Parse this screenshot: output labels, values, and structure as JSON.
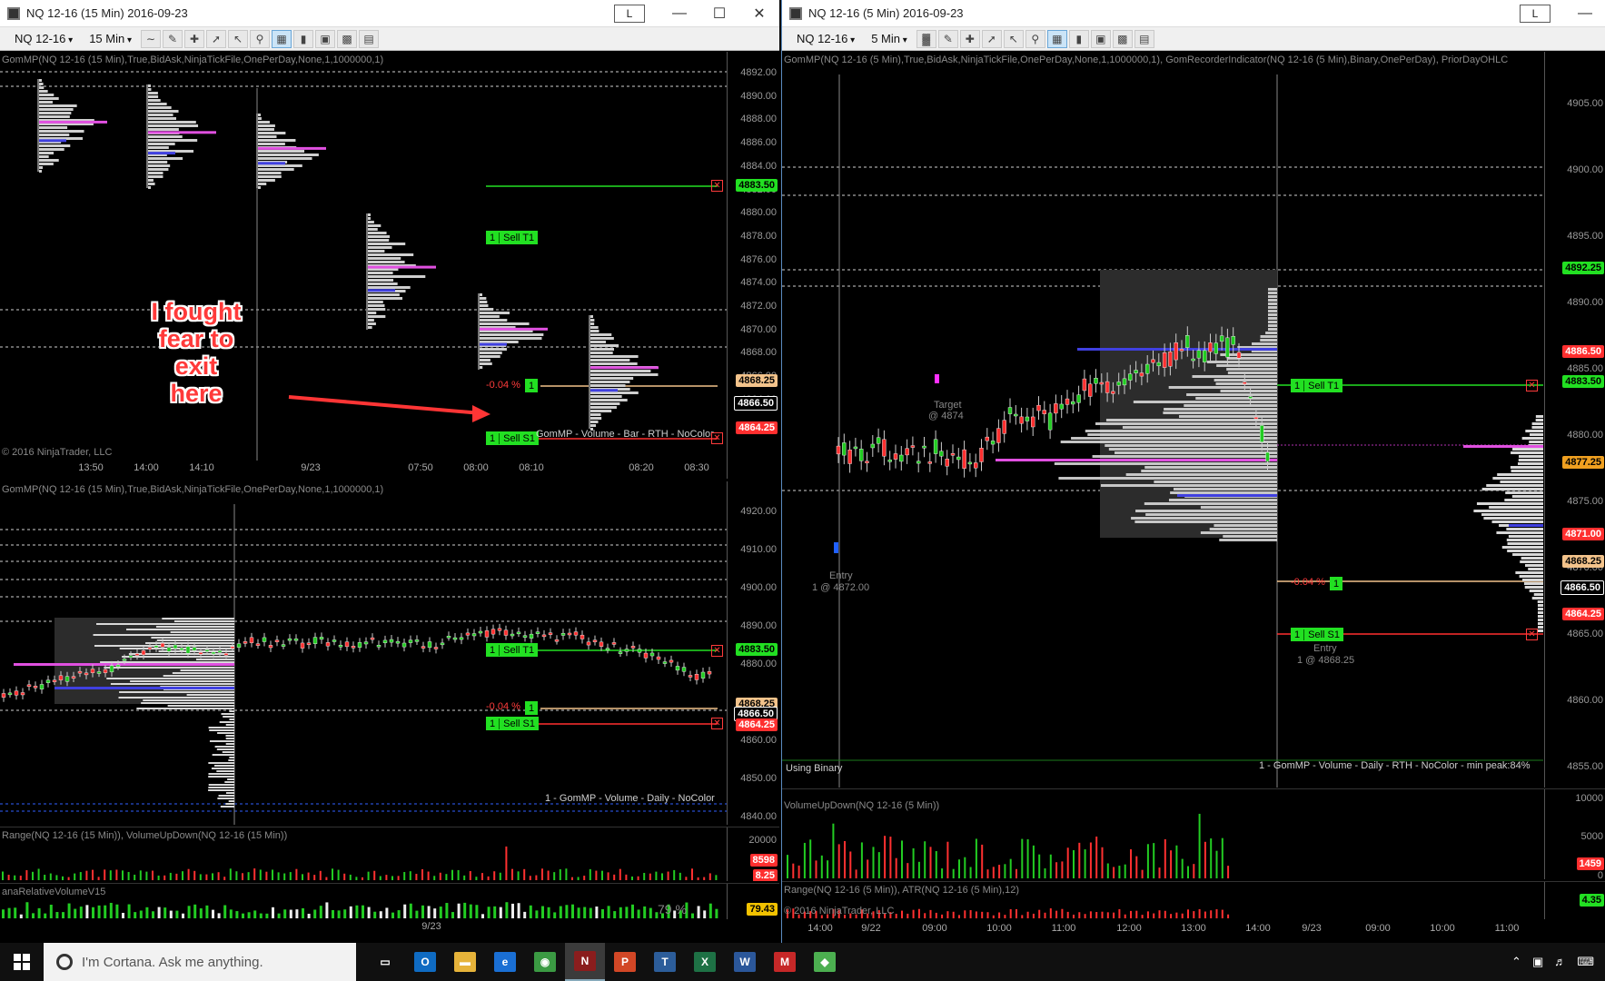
{
  "left_window": {
    "title": "NQ 12-16 (15 Min)  2016-09-23",
    "link_label": "L",
    "toolbar": {
      "instrument": "NQ 12-16",
      "interval": "15 Min"
    },
    "top_chart": {
      "indicator_label": "GomMP(NQ 12-16 (15 Min),True,BidAsk,NinjaTickFile,OnePerDay,None,1,1000000,1)",
      "copyright": "© 2016 NinjaTrader, LLC",
      "price_ticks": [
        "4892.00",
        "4890.00",
        "4888.00",
        "4886.00",
        "4884.00",
        "4882.00",
        "4880.00",
        "4878.00",
        "4876.00",
        "4874.00",
        "4872.00",
        "4870.00",
        "4868.00",
        "4866.00",
        "4864.00"
      ],
      "price_tags": [
        {
          "label": "4883.50",
          "bg": "#22e022",
          "fg": "#000"
        },
        {
          "label": "4868.25",
          "bg": "#f3c38b",
          "fg": "#000"
        },
        {
          "label": "4866.50",
          "bg": "#000",
          "fg": "#fff"
        },
        {
          "label": "4864.25",
          "bg": "#ff2f2f",
          "fg": "#fff"
        }
      ],
      "sell_t1": {
        "qty": "1",
        "label": "Sell T1"
      },
      "sell_s1": {
        "qty": "1",
        "label": "Sell S1"
      },
      "pnl_pct": "-0.04 %",
      "pos_qty": "1",
      "profile_note": "GomMP - Volume - Bar - RTH - NoColor",
      "time_labels": [
        "13:50",
        "14:00",
        "14:10",
        "9/23",
        "07:50",
        "08:00",
        "08:10",
        "08:20",
        "08:30"
      ]
    },
    "bottom_chart": {
      "indicator_label": "GomMP(NQ 12-16 (15 Min),True,BidAsk,NinjaTickFile,OnePerDay,None,1,1000000,1)",
      "price_ticks": [
        "4920.00",
        "4910.00",
        "4900.00",
        "4890.00",
        "4880.00",
        "4870.00",
        "4860.00",
        "4850.00",
        "4840.00"
      ],
      "price_tags": [
        {
          "label": "4883.50",
          "bg": "#22e022",
          "fg": "#000"
        },
        {
          "label": "4868.25",
          "bg": "#f3c38b",
          "fg": "#000"
        },
        {
          "label": "4866.50",
          "bg": "#000",
          "fg": "#fff"
        },
        {
          "label": "4864.25",
          "bg": "#ff2f2f",
          "fg": "#fff"
        }
      ],
      "sell_t1": {
        "qty": "1",
        "label": "Sell T1"
      },
      "sell_s1": {
        "qty": "1",
        "label": "Sell S1"
      },
      "pnl_pct": "-0.04 %",
      "pos_qty": "1",
      "profile_note": "1 - GomMP - Volume - Daily - NoColor"
    },
    "range_panel": {
      "label": "Range(NQ 12-16 (15 Min)), VolumeUpDown(NQ 12-16 (15 Min))",
      "tick": "20000",
      "tags": [
        {
          "label": "8598",
          "bg": "#ff2f2f",
          "fg": "#fff"
        },
        {
          "label": "8.25",
          "bg": "#ff2f2f",
          "fg": "#fff"
        }
      ]
    },
    "relvol_panel": {
      "label": "anaRelativeVolumeV15",
      "pct": "79 %",
      "tag": {
        "label": "79.43",
        "bg": "#f2c200",
        "fg": "#000"
      }
    },
    "x_label": "9/23"
  },
  "annotation": {
    "lines": [
      "I fought",
      "fear to exit",
      "here"
    ]
  },
  "right_window": {
    "title": "NQ 12-16 (5 Min)  2016-09-23",
    "link_label": "L",
    "toolbar": {
      "instrument": "NQ 12-16",
      "interval": "5 Min"
    },
    "main_chart": {
      "indicator_label": "GomMP(NQ 12-16 (5 Min),True,BidAsk,NinjaTickFile,OnePerDay,None,1,1000000,1), GomRecorderIndicator(NQ 12-16 (5 Min),Binary,OnePerDay), PriorDayOHLC",
      "price_ticks": [
        "4905.00",
        "4900.00",
        "4895.00",
        "4890.00",
        "4885.00",
        "4880.00",
        "4875.00",
        "4870.00",
        "4865.00",
        "4860.00",
        "4855.00"
      ],
      "price_tags": [
        {
          "label": "4892.25",
          "bg": "#22e022",
          "fg": "#000"
        },
        {
          "label": "4886.50",
          "bg": "#ff2f2f",
          "fg": "#fff"
        },
        {
          "label": "4883.50",
          "bg": "#22e022",
          "fg": "#000"
        },
        {
          "label": "4877.25",
          "bg": "#f0a020",
          "fg": "#000"
        },
        {
          "label": "4871.00",
          "bg": "#ff2f2f",
          "fg": "#fff"
        },
        {
          "label": "4868.25",
          "bg": "#f3c38b",
          "fg": "#000"
        },
        {
          "label": "4866.50",
          "bg": "#000",
          "fg": "#fff"
        },
        {
          "label": "4864.25",
          "bg": "#ff2f2f",
          "fg": "#fff"
        }
      ],
      "sell_t1": {
        "qty": "1",
        "label": "Sell T1"
      },
      "sell_s1": {
        "qty": "1",
        "label": "Sell S1"
      },
      "pnl_pct": "-0.04 %",
      "pos_qty": "1",
      "target_label": "Target",
      "target_price": "@ 4874",
      "entry1_label": "Entry",
      "entry1_detail": "1 @ 4872.00",
      "entry2_label": "Entry",
      "entry2_detail": "1 @ 4868.25",
      "binary_label": "Using Binary",
      "profile_note": "1 - GomMP - Volume - Daily - RTH - NoColor - min peak:84%"
    },
    "volume_panel": {
      "label": "VolumeUpDown(NQ 12-16 (5 Min))",
      "ticks": [
        "10000",
        "5000",
        "0"
      ],
      "tag": {
        "label": "1459",
        "bg": "#ff2f2f",
        "fg": "#fff"
      }
    },
    "range_panel": {
      "label": "Range(NQ 12-16 (5 Min)), ATR(NQ 12-16 (5 Min),12)",
      "copyright": "© 2016 NinjaTrader, LLC",
      "tag": {
        "label": "4.35",
        "bg": "#22e022",
        "fg": "#000"
      }
    },
    "time_labels": [
      "14:00",
      "9/22",
      "09:00",
      "10:00",
      "11:00",
      "12:00",
      "13:00",
      "14:00",
      "9/23",
      "09:00",
      "10:00",
      "11:00"
    ]
  },
  "taskbar": {
    "search_placeholder": "I'm Cortana. Ask me anything.",
    "apps": [
      {
        "name": "task-view",
        "glyph": "▭",
        "color": "#101010"
      },
      {
        "name": "outlook",
        "glyph": "O",
        "color": "#0f6bc2"
      },
      {
        "name": "file-explorer",
        "glyph": "▬",
        "color": "#e6b33a"
      },
      {
        "name": "edge",
        "glyph": "e",
        "color": "#1a6fd4"
      },
      {
        "name": "chrome",
        "glyph": "◉",
        "color": "#3b9a43"
      },
      {
        "name": "ninjatrader",
        "glyph": "N",
        "color": "#8a1d1d"
      },
      {
        "name": "powerpoint",
        "glyph": "P",
        "color": "#d24726"
      },
      {
        "name": "tws",
        "glyph": "T",
        "color": "#2c5d9a"
      },
      {
        "name": "excel",
        "glyph": "X",
        "color": "#1e7145"
      },
      {
        "name": "word",
        "glyph": "W",
        "color": "#2b579a"
      },
      {
        "name": "app-m",
        "glyph": "M",
        "color": "#c62828"
      },
      {
        "name": "app-green",
        "glyph": "◆",
        "color": "#4caf50"
      }
    ]
  }
}
